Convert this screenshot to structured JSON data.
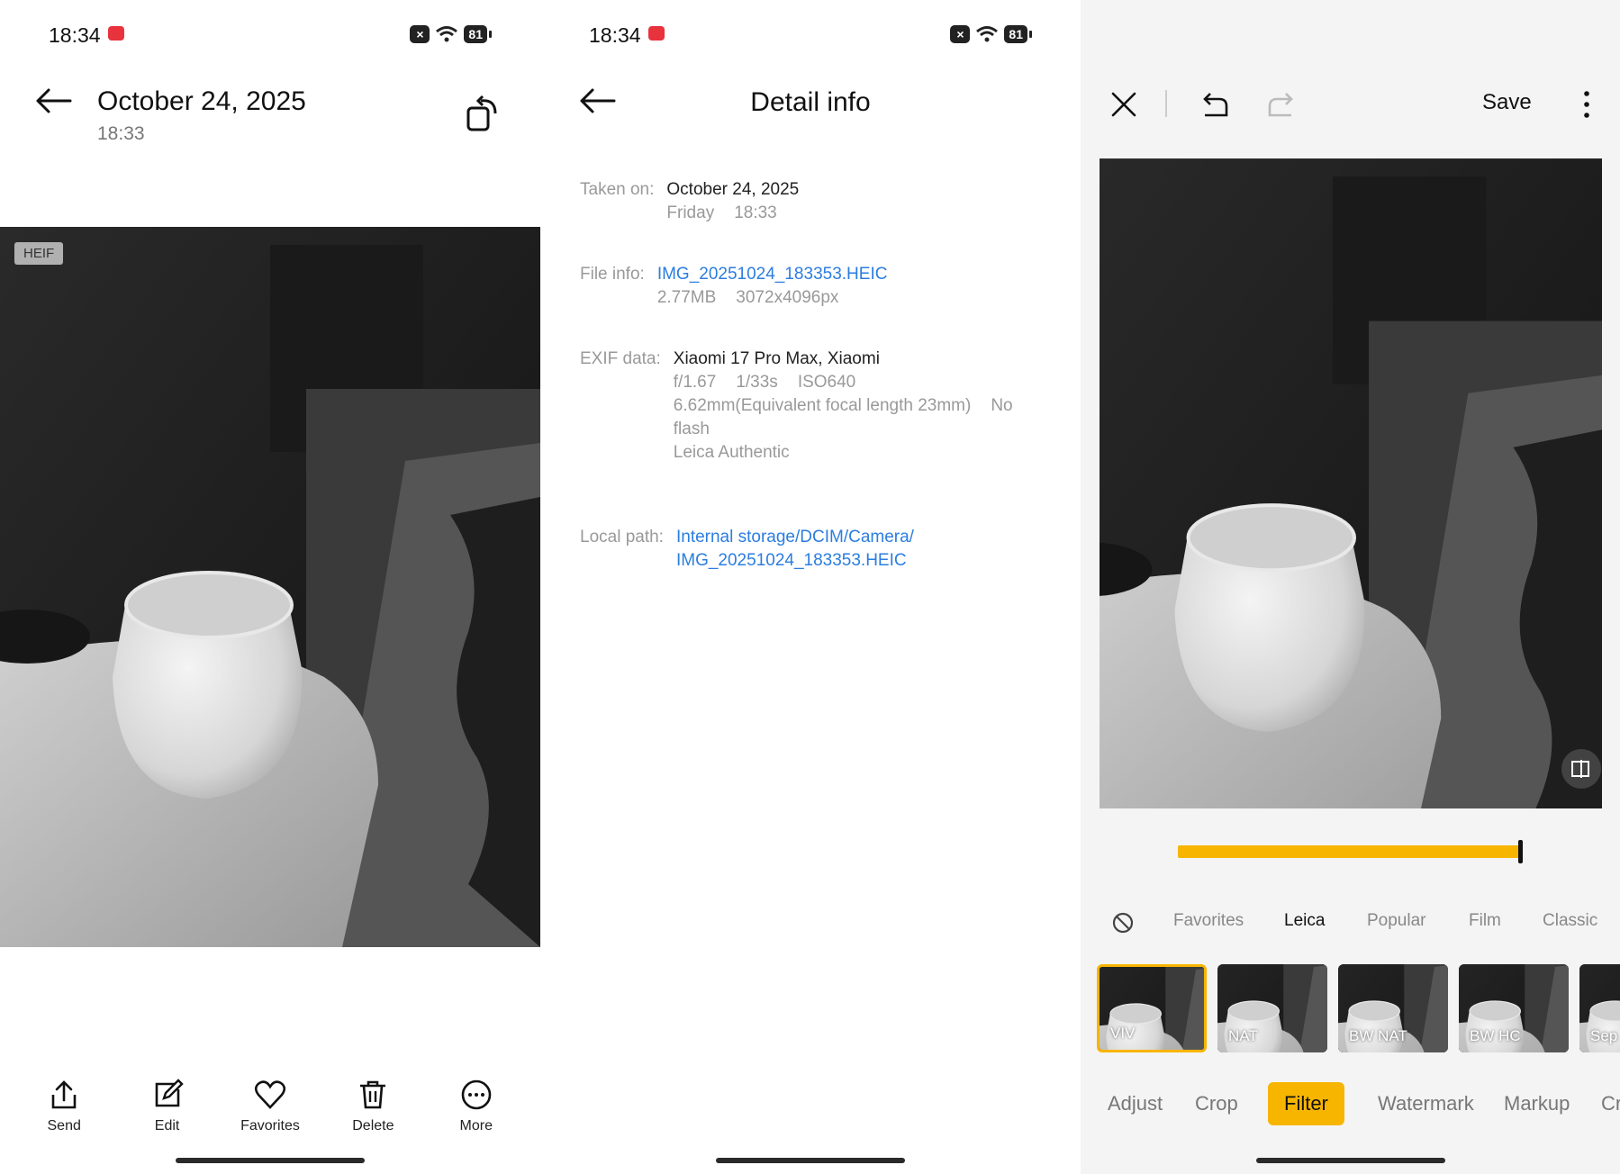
{
  "status": {
    "time": "18:34",
    "battery": "81"
  },
  "viewer": {
    "title": "October 24, 2025",
    "subtitle": "18:33",
    "badge": "HEIF",
    "actions": [
      {
        "label": "Send",
        "icon": "share-icon"
      },
      {
        "label": "Edit",
        "icon": "edit-icon"
      },
      {
        "label": "Favorites",
        "icon": "heart-icon"
      },
      {
        "label": "Delete",
        "icon": "trash-icon"
      },
      {
        "label": "More",
        "icon": "more-icon"
      }
    ]
  },
  "detail": {
    "title": "Detail info",
    "taken_label": "Taken on:",
    "taken_date": "October 24, 2025",
    "taken_day": "Friday",
    "taken_time": "18:33",
    "file_label": "File info:",
    "file_name": "IMG_20251024_183353.HEIC",
    "file_size": "2.77MB",
    "file_res": "3072x4096px",
    "exif_label": "EXIF data:",
    "exif_device": "Xiaomi 17 Pro Max, Xiaomi",
    "exif_aperture": "f/1.67",
    "exif_shutter": "1/33s",
    "exif_iso": "ISO640",
    "exif_focal": "6.62mm(Equivalent focal length 23mm)",
    "exif_flash": "No flash",
    "exif_style": "Leica Authentic",
    "path_label": "Local path:",
    "path_line1": "Internal storage/DCIM/Camera/",
    "path_line2": "IMG_20251024_183353.HEIC"
  },
  "editor": {
    "save_label": "Save",
    "intensity": 1.0,
    "accent": "#f7b500",
    "categories": [
      "Favorites",
      "Leica",
      "Popular",
      "Film",
      "Classic"
    ],
    "active_category": "Leica",
    "filters": [
      "VIV",
      "NAT",
      "BW NAT",
      "BW HC",
      "Sep"
    ],
    "selected_filter": "VIV",
    "tabs": [
      "Adjust",
      "Crop",
      "Filter",
      "Watermark",
      "Markup",
      "Cr"
    ],
    "active_tab": "Filter"
  }
}
